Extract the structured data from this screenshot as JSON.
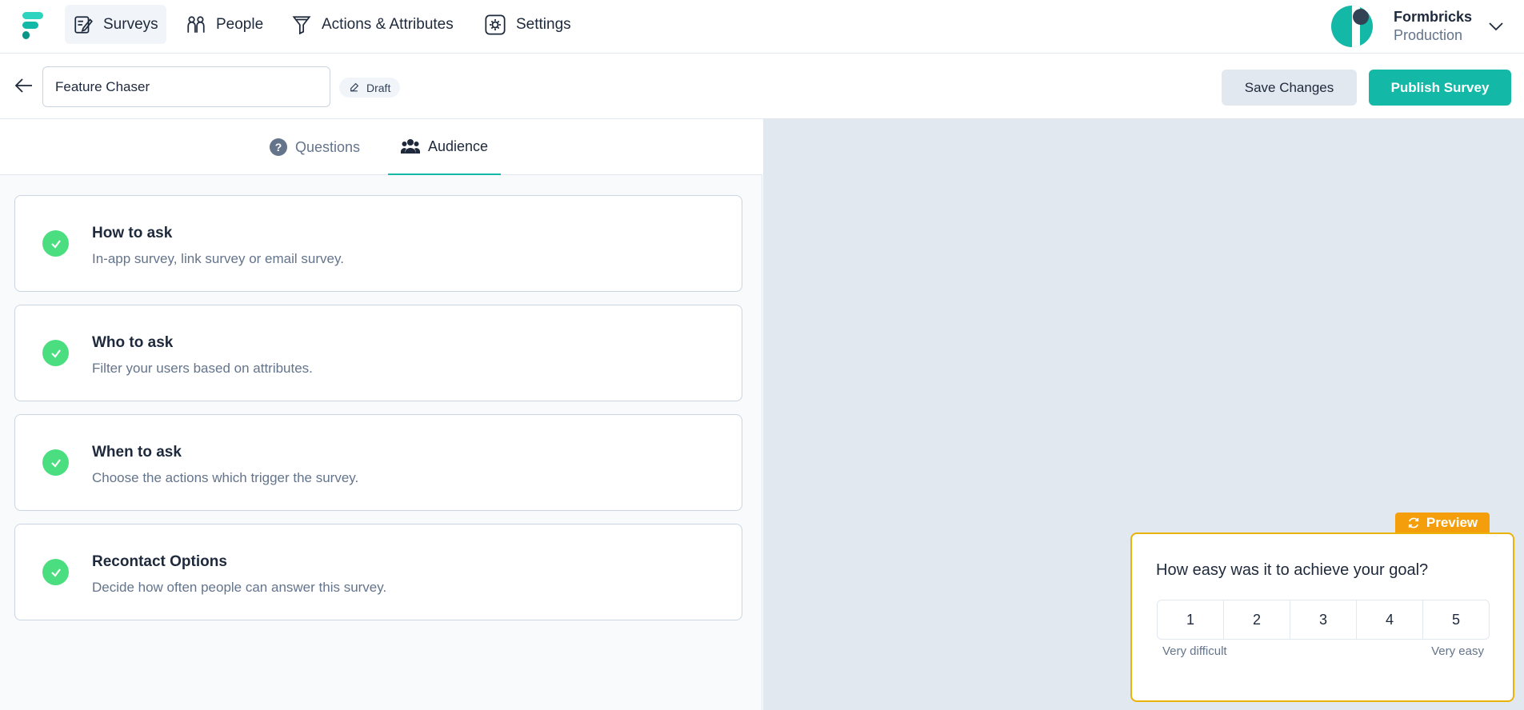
{
  "nav": {
    "items": [
      {
        "label": "Surveys",
        "icon": "survey-edit-icon"
      },
      {
        "label": "People",
        "icon": "people-icon"
      },
      {
        "label": "Actions & Attributes",
        "icon": "filter-icon"
      },
      {
        "label": "Settings",
        "icon": "settings-gear-icon"
      }
    ],
    "active": "Surveys"
  },
  "account": {
    "name": "Formbricks",
    "environment": "Production"
  },
  "header": {
    "survey_title": "Feature Chaser",
    "status_badge": "Draft",
    "save_label": "Save Changes",
    "publish_label": "Publish Survey"
  },
  "tabs": [
    {
      "label": "Questions",
      "icon": "question-circle-icon"
    },
    {
      "label": "Audience",
      "icon": "users-group-icon"
    }
  ],
  "active_tab": "Audience",
  "cards": [
    {
      "title": "How to ask",
      "description": "In-app survey, link survey or email survey."
    },
    {
      "title": "Who to ask",
      "description": "Filter your users based on attributes."
    },
    {
      "title": "When to ask",
      "description": "Choose the actions which trigger the survey."
    },
    {
      "title": "Recontact Options",
      "description": "Decide how often people can answer this survey."
    }
  ],
  "preview": {
    "tag_label": "Preview",
    "question": "How easy was it to achieve your goal?",
    "scale": [
      "1",
      "2",
      "3",
      "4",
      "5"
    ],
    "lower_label": "Very difficult",
    "upper_label": "Very easy"
  },
  "colors": {
    "brand": "#14b8a6",
    "check": "#4ade80",
    "preview_accent": "#f59e0b"
  }
}
